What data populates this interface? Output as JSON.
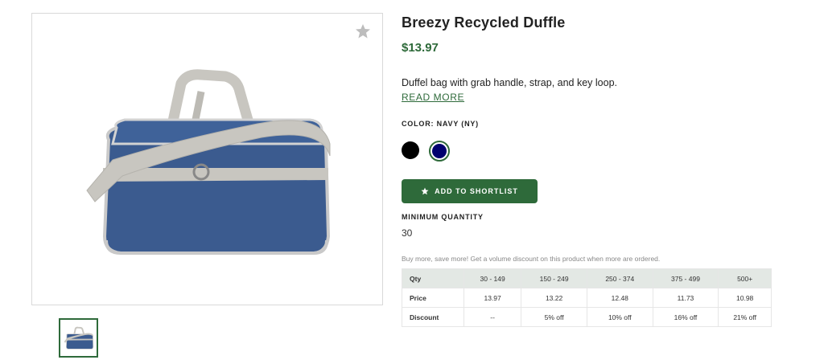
{
  "product": {
    "title": "Breezy Recycled Duffle",
    "price": "$13.97",
    "description": "Duffel bag with grab handle, strap, and key loop.",
    "read_more": "READ MORE",
    "color_label": "COLOR: NAVY (NY)",
    "colors": [
      {
        "name": "Black",
        "hex": "#000000"
      },
      {
        "name": "Navy",
        "hex": "#00006e",
        "selected": true
      }
    ],
    "shortlist_label": "ADD TO SHORTLIST",
    "min_quantity_label": "MINIMUM QUANTITY",
    "min_quantity_value": "30",
    "volume_note": "Buy more, save more! Get a volume discount on this product when more are ordered."
  },
  "pricing_table": {
    "headers": [
      "Qty",
      "30 - 149",
      "150 - 249",
      "250 - 374",
      "375 - 499",
      "500+"
    ],
    "rows": [
      [
        "Price",
        "13.97",
        "13.22",
        "12.48",
        "11.73",
        "10.98"
      ],
      [
        "Discount",
        "--",
        "5% off",
        "10% off",
        "16% off",
        "21% off"
      ]
    ]
  },
  "icons": {
    "favorite": "star-icon",
    "shortlist": "star-icon"
  },
  "colors": {
    "brand_green": "#2e6a3a",
    "table_header_bg": "#e3e8e4",
    "bag_navy": "#3b5b8f"
  }
}
